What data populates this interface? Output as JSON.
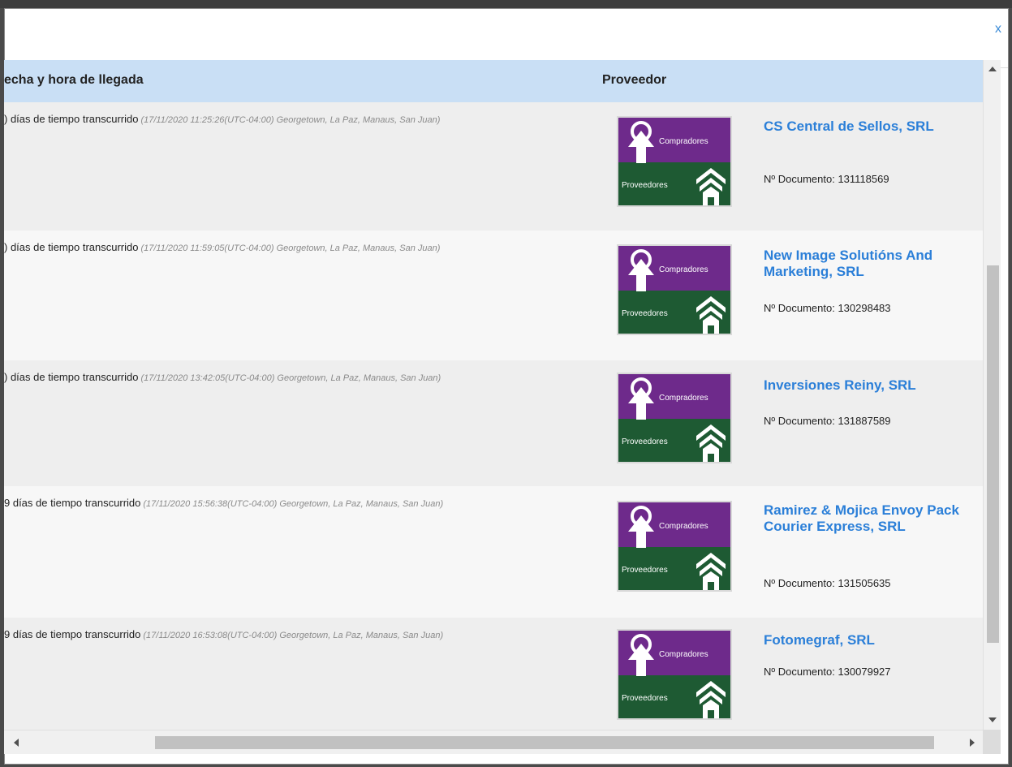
{
  "dialog": {
    "close_label": "x"
  },
  "table": {
    "headers": {
      "date": "echa y hora de llegada",
      "provider": "Proveedor"
    },
    "rows": [
      {
        "elapsed": ") días de tiempo transcurrido",
        "timestamp": "(17/11/2020 11:25:26(UTC-04:00) Georgetown, La Paz, Manaus, San Juan)",
        "name": "CS Central de Sellos, SRL",
        "doc": "Nº Documento: 131118569"
      },
      {
        "elapsed": ") días de tiempo transcurrido",
        "timestamp": "(17/11/2020 11:59:05(UTC-04:00) Georgetown, La Paz, Manaus, San Juan)",
        "name": "New Image Solutións And Marketing, SRL",
        "doc": "Nº Documento: 130298483"
      },
      {
        "elapsed": ") días de tiempo transcurrido",
        "timestamp": "(17/11/2020 13:42:05(UTC-04:00) Georgetown, La Paz, Manaus, San Juan)",
        "name": "Inversiones Reiny, SRL",
        "doc": "Nº Documento: 131887589"
      },
      {
        "elapsed": "9 días de tiempo transcurrido",
        "timestamp": "(17/11/2020 15:56:38(UTC-04:00) Georgetown, La Paz, Manaus, San Juan)",
        "name": "Ramirez & Mojica Envoy Pack Courier Express, SRL",
        "doc": "Nº Documento: 131505635"
      },
      {
        "elapsed": "9 días de tiempo transcurrido",
        "timestamp": "(17/11/2020 16:53:08(UTC-04:00) Georgetown, La Paz, Manaus, San Juan)",
        "name": "Fotomegraf, SRL",
        "doc": "Nº Documento: 130079927"
      }
    ]
  },
  "logo": {
    "buyers_label": "Compradores",
    "suppliers_label": "Proveedores",
    "buyers_color": "#6e2a8b",
    "suppliers_color": "#1e5a33"
  },
  "colors": {
    "header_bg": "#c9dff5",
    "link": "#2b7fd8",
    "close": "#3a8ad6"
  }
}
